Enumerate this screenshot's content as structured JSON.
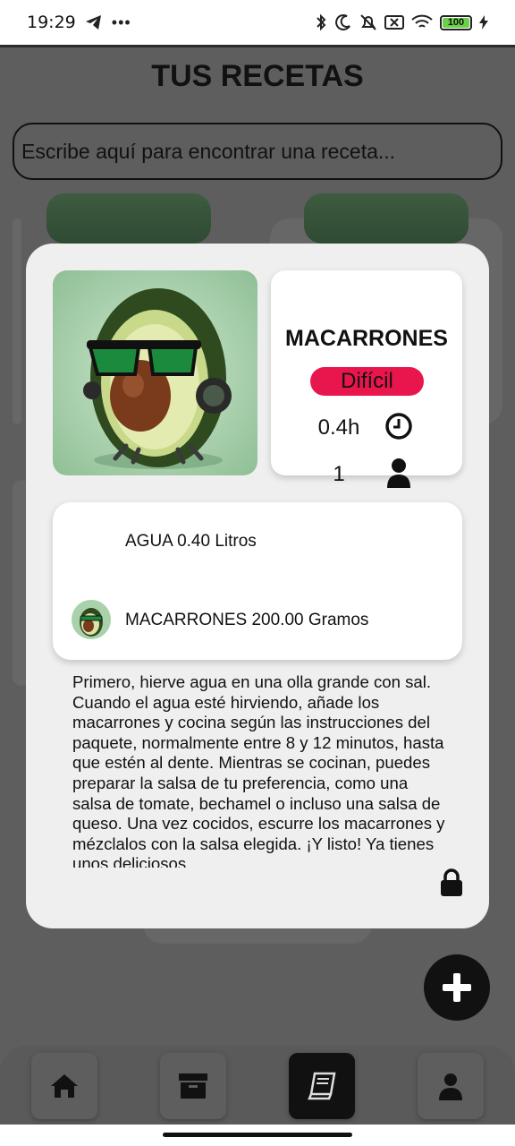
{
  "status_bar": {
    "time": "19:29",
    "battery": "100"
  },
  "page": {
    "title": "TUS RECETAS",
    "search_placeholder": "Escribe aquí para encontrar una receta..."
  },
  "nav": {
    "items": [
      {
        "icon": "home-icon",
        "active": false
      },
      {
        "icon": "archive-icon",
        "active": false
      },
      {
        "icon": "book-icon",
        "active": true
      },
      {
        "icon": "user-icon",
        "active": false
      }
    ]
  },
  "fab": {
    "icon": "plus-icon"
  },
  "recipe": {
    "name": "MACARRONES",
    "difficulty": "Difícil",
    "difficulty_color": "#e8164c",
    "time": "0.4h",
    "servings": "1",
    "ingredients": [
      {
        "text": "AGUA 0.40 Litros",
        "has_image": false
      },
      {
        "text": "MACARRONES 200.00 Gramos",
        "has_image": true
      }
    ],
    "instructions": "Primero, hierve agua en una olla grande con sal. Cuando el agua esté hirviendo, añade los macarrones y cocina según las instrucciones del paquete, normalmente entre 8 y 12 minutos, hasta que estén al dente. Mientras se cocinan, puedes preparar la salsa de tu preferencia, como una salsa de tomate, bechamel o incluso una salsa de queso. Una vez cocidos, escurre los macarrones y mézclalos con la salsa elegida. ¡Y listo! Ya tienes unos deliciosos"
  }
}
